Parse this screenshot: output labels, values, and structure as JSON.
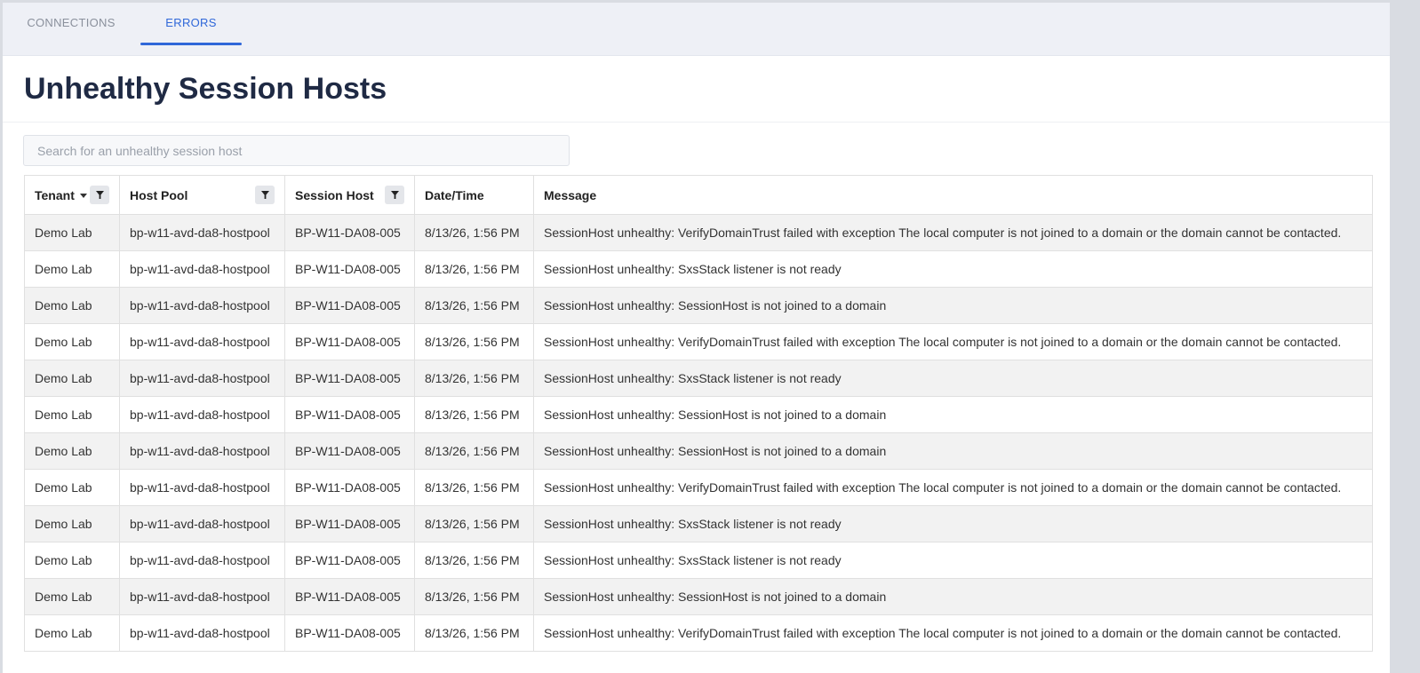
{
  "tabs": [
    {
      "label": "CONNECTIONS",
      "active": false
    },
    {
      "label": "ERRORS",
      "active": true
    }
  ],
  "page_title": "Unhealthy Session Hosts",
  "search": {
    "placeholder": "Search for an unhealthy session host",
    "value": ""
  },
  "colors": {
    "accent": "#2f67d9",
    "title": "#1f2a44",
    "tab_bar_bg": "#eef0f6"
  },
  "table": {
    "columns": [
      {
        "label": "Tenant",
        "sortable": true,
        "sort_direction": "desc",
        "filter": true,
        "filter_icon": "filter-icon"
      },
      {
        "label": "Host Pool",
        "filter": true,
        "filter_icon": "filter-icon"
      },
      {
        "label": "Session Host",
        "filter": true,
        "filter_icon": "filter-icon"
      },
      {
        "label": "Date/Time",
        "filter": false
      },
      {
        "label": "Message",
        "filter": false
      }
    ],
    "rows": [
      [
        "Demo Lab",
        "bp-w11-avd-da8-hostpool",
        "BP-W11-DA08-005",
        "8/13/26, 1:56 PM",
        "SessionHost unhealthy: VerifyDomainTrust failed with exception The local computer is not joined to a domain or the domain cannot be contacted."
      ],
      [
        "Demo Lab",
        "bp-w11-avd-da8-hostpool",
        "BP-W11-DA08-005",
        "8/13/26, 1:56 PM",
        "SessionHost unhealthy: SxsStack listener is not ready"
      ],
      [
        "Demo Lab",
        "bp-w11-avd-da8-hostpool",
        "BP-W11-DA08-005",
        "8/13/26, 1:56 PM",
        "SessionHost unhealthy: SessionHost is not joined to a domain"
      ],
      [
        "Demo Lab",
        "bp-w11-avd-da8-hostpool",
        "BP-W11-DA08-005",
        "8/13/26, 1:56 PM",
        "SessionHost unhealthy: VerifyDomainTrust failed with exception The local computer is not joined to a domain or the domain cannot be contacted."
      ],
      [
        "Demo Lab",
        "bp-w11-avd-da8-hostpool",
        "BP-W11-DA08-005",
        "8/13/26, 1:56 PM",
        "SessionHost unhealthy: SxsStack listener is not ready"
      ],
      [
        "Demo Lab",
        "bp-w11-avd-da8-hostpool",
        "BP-W11-DA08-005",
        "8/13/26, 1:56 PM",
        "SessionHost unhealthy: SessionHost is not joined to a domain"
      ],
      [
        "Demo Lab",
        "bp-w11-avd-da8-hostpool",
        "BP-W11-DA08-005",
        "8/13/26, 1:56 PM",
        "SessionHost unhealthy: SessionHost is not joined to a domain"
      ],
      [
        "Demo Lab",
        "bp-w11-avd-da8-hostpool",
        "BP-W11-DA08-005",
        "8/13/26, 1:56 PM",
        "SessionHost unhealthy: VerifyDomainTrust failed with exception The local computer is not joined to a domain or the domain cannot be contacted."
      ],
      [
        "Demo Lab",
        "bp-w11-avd-da8-hostpool",
        "BP-W11-DA08-005",
        "8/13/26, 1:56 PM",
        "SessionHost unhealthy: SxsStack listener is not ready"
      ],
      [
        "Demo Lab",
        "bp-w11-avd-da8-hostpool",
        "BP-W11-DA08-005",
        "8/13/26, 1:56 PM",
        "SessionHost unhealthy: SxsStack listener is not ready"
      ],
      [
        "Demo Lab",
        "bp-w11-avd-da8-hostpool",
        "BP-W11-DA08-005",
        "8/13/26, 1:56 PM",
        "SessionHost unhealthy: SessionHost is not joined to a domain"
      ],
      [
        "Demo Lab",
        "bp-w11-avd-da8-hostpool",
        "BP-W11-DA08-005",
        "8/13/26, 1:56 PM",
        "SessionHost unhealthy: VerifyDomainTrust failed with exception The local computer is not joined to a domain or the domain cannot be contacted."
      ]
    ]
  }
}
